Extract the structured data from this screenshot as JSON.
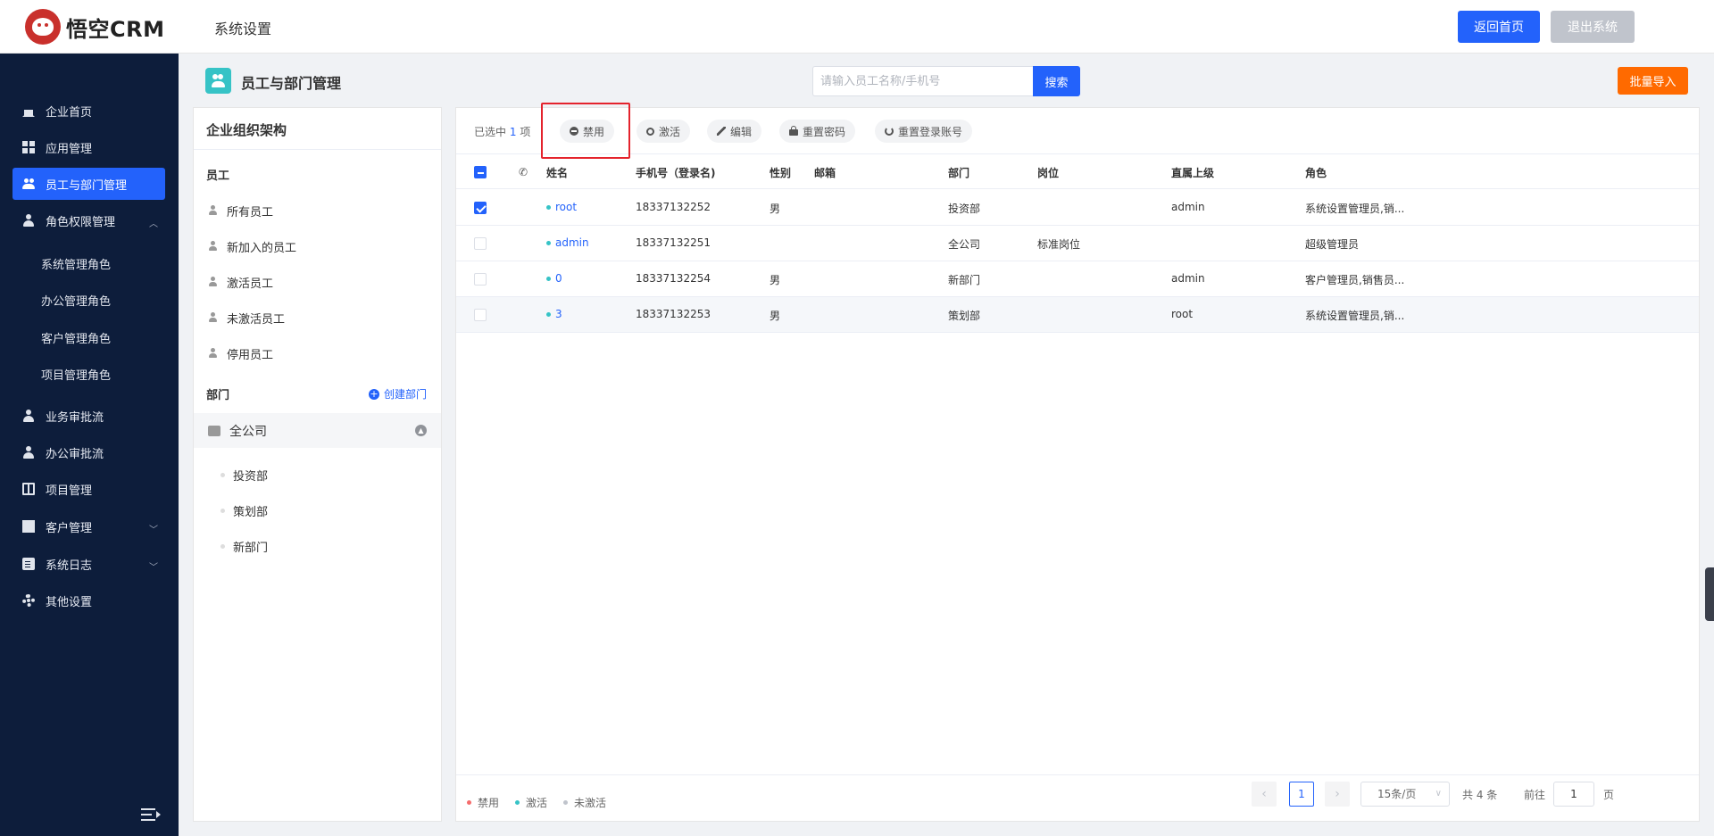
{
  "header": {
    "logo_text": "悟空CRM",
    "section_title": "系统设置",
    "home_label": "返回首页",
    "logout_label": "退出系统"
  },
  "sidebar": {
    "items": [
      {
        "label": "企业首页",
        "icon": "home-icon"
      },
      {
        "label": "应用管理",
        "icon": "grid-icon"
      },
      {
        "label": "员工与部门管理",
        "icon": "users-icon",
        "active": true
      },
      {
        "label": "角色权限管理",
        "icon": "user-icon",
        "expanded": true
      },
      {
        "label": "业务审批流",
        "icon": "user-icon"
      },
      {
        "label": "办公审批流",
        "icon": "user-icon"
      },
      {
        "label": "项目管理",
        "icon": "book-icon"
      },
      {
        "label": "客户管理",
        "icon": "building-icon"
      },
      {
        "label": "系统日志",
        "icon": "clipboard-icon"
      },
      {
        "label": "其他设置",
        "icon": "gear-icon"
      }
    ],
    "role_sub_items": [
      "系统管理角色",
      "办公管理角色",
      "客户管理角色",
      "项目管理角色"
    ]
  },
  "page": {
    "title": "员工与部门管理",
    "search_placeholder": "请输入员工名称/手机号",
    "search_value": "",
    "search_label": "搜索",
    "import_label": "批量导入"
  },
  "org": {
    "title": "企业组织架构",
    "employee_section": "员工",
    "employee_filters": [
      "所有员工",
      "新加入的员工",
      "激活员工",
      "未激活员工",
      "停用员工"
    ],
    "dept_section": "部门",
    "create_dept_label": "创建部门",
    "root_dept": "全公司",
    "child_depts": [
      "投资部",
      "策划部",
      "新部门"
    ]
  },
  "toolbar": {
    "selected_prefix": "已选中",
    "selected_count": "1",
    "selected_suffix": "项",
    "actions": [
      "禁用",
      "激活",
      "编辑",
      "重置密码",
      "重置登录账号"
    ]
  },
  "table": {
    "columns": [
      "姓名",
      "手机号（登录名)",
      "性别",
      "邮箱",
      "部门",
      "岗位",
      "直属上级",
      "角色"
    ],
    "rows": [
      {
        "name": "root",
        "phone": "18337132252",
        "gender": "男",
        "email": "",
        "dept": "投资部",
        "post": "",
        "superior": "admin",
        "role": "系统设置管理员,销...",
        "checked": true
      },
      {
        "name": "admin",
        "phone": "18337132251",
        "gender": "",
        "email": "",
        "dept": "全公司",
        "post": "标准岗位",
        "superior": "",
        "role": "超级管理员",
        "checked": false
      },
      {
        "name": "0",
        "phone": "18337132254",
        "gender": "男",
        "email": "",
        "dept": "新部门",
        "post": "",
        "superior": "admin",
        "role": "客户管理员,销售员...",
        "checked": false
      },
      {
        "name": "3",
        "phone": "18337132253",
        "gender": "男",
        "email": "",
        "dept": "策划部",
        "post": "",
        "superior": "root",
        "role": "系统设置管理员,销...",
        "checked": false
      }
    ]
  },
  "footer": {
    "legend": [
      {
        "label": "禁用",
        "color": "#f56c6c"
      },
      {
        "label": "激活",
        "color": "#36c3c6"
      },
      {
        "label": "未激活",
        "color": "#c0c4cc"
      }
    ],
    "current_page": "1",
    "page_size": "15条/页",
    "total": "共 4 条",
    "goto_label": "前往",
    "goto_value": "1",
    "page_unit": "页"
  },
  "colors": {
    "primary": "#2362fb",
    "sidebar_bg": "#0d1d3b",
    "import_orange": "#ff6a00",
    "highlight_red": "#e4232d"
  }
}
